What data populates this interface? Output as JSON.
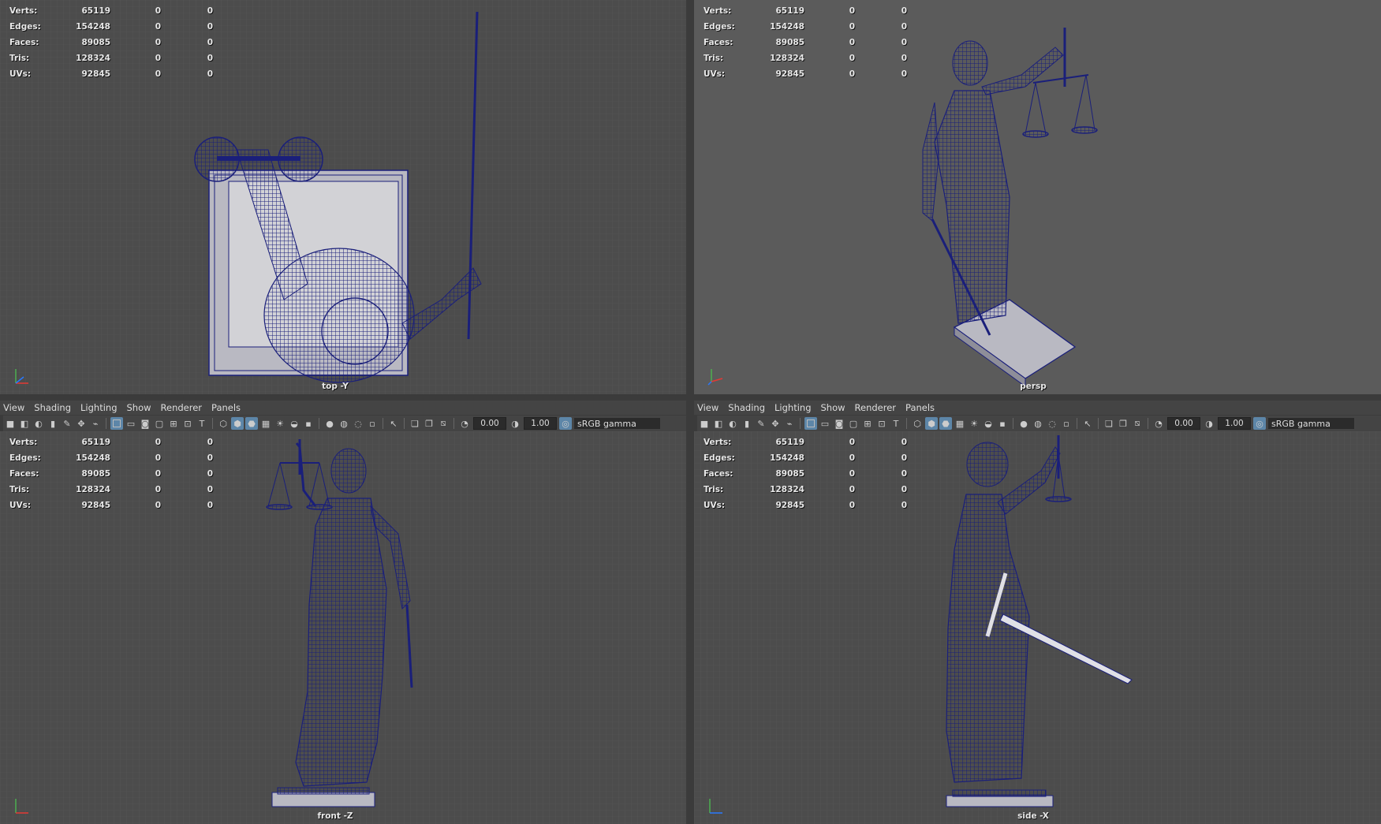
{
  "stats": {
    "rows": [
      {
        "label": "Verts:",
        "v1": "65119",
        "v2": "0",
        "v3": "0"
      },
      {
        "label": "Edges:",
        "v1": "154248",
        "v2": "0",
        "v3": "0"
      },
      {
        "label": "Faces:",
        "v1": "89085",
        "v2": "0",
        "v3": "0"
      },
      {
        "label": "Tris:",
        "v1": "128324",
        "v2": "0",
        "v3": "0"
      },
      {
        "label": "UVs:",
        "v1": "92845",
        "v2": "0",
        "v3": "0"
      }
    ]
  },
  "viewports": {
    "top": {
      "camera": "top -Y"
    },
    "persp": {
      "camera": "persp"
    },
    "front": {
      "camera": "front -Z"
    },
    "side": {
      "camera": "side -X"
    }
  },
  "menu": {
    "items": [
      "View",
      "Shading",
      "Lighting",
      "Show",
      "Renderer",
      "Panels"
    ]
  },
  "toolbar": {
    "exposure": "0.00",
    "gamma_value": "1.00",
    "color_space": "sRGB gamma"
  },
  "colors": {
    "wireframe": "#1a1f7a",
    "viewport_bg": "#4e4e4e",
    "persp_bg": "#5b5b5b",
    "active_button": "#5d86a8"
  }
}
